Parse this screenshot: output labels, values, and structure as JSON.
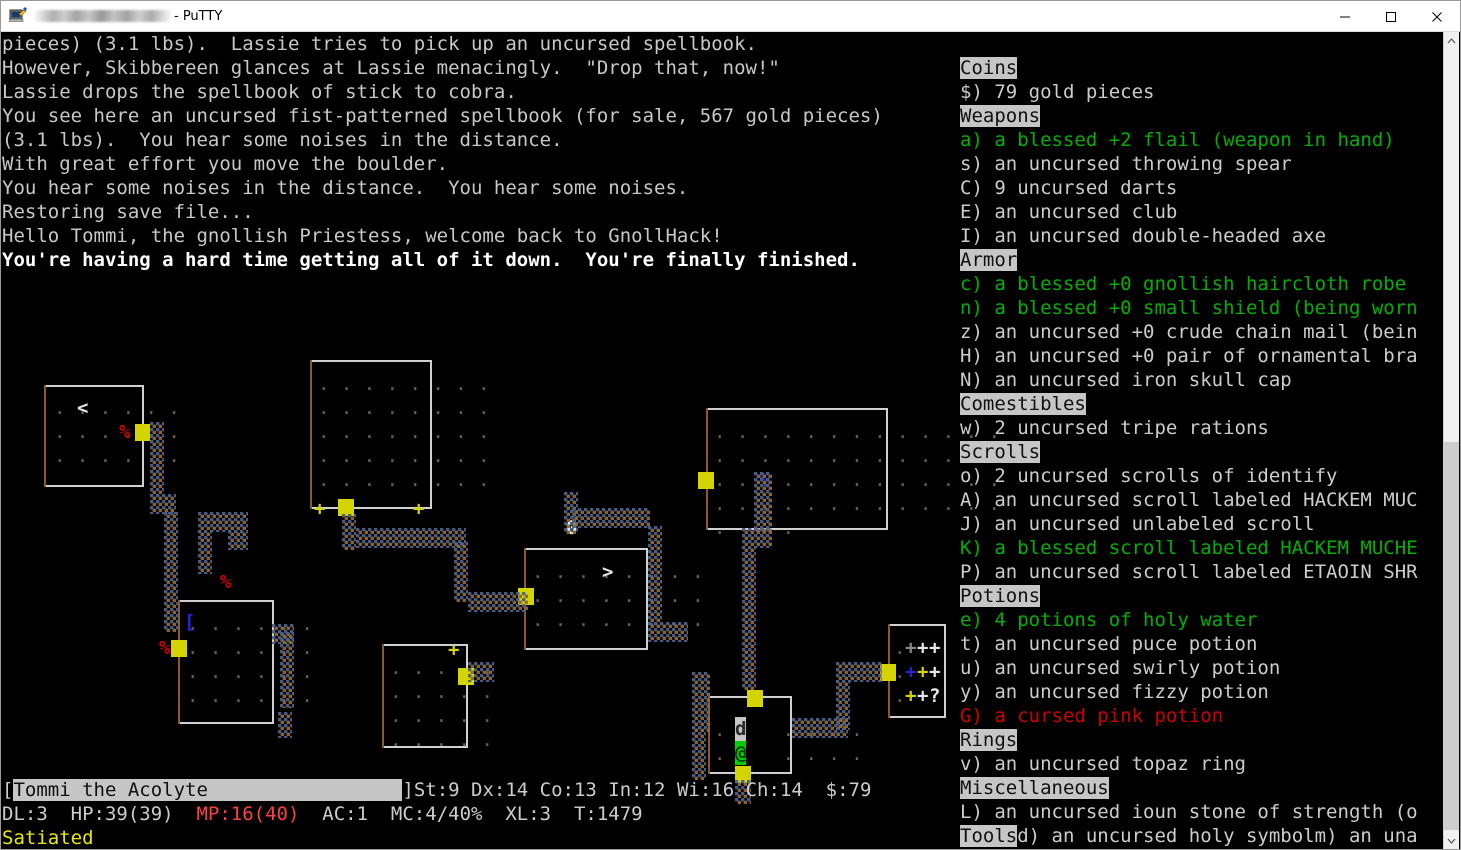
{
  "window": {
    "title_suffix": " - PuTTY",
    "title_redacted": true,
    "icon": "putty-icon",
    "controls": [
      {
        "name": "minimize-button",
        "label": "—"
      },
      {
        "name": "maximize-button",
        "label": "☐"
      },
      {
        "name": "close-button",
        "label": "✕"
      }
    ]
  },
  "messages": [
    {
      "text": "pieces) (3.1 lbs).  Lassie tries to pick up an uncursed spellbook.",
      "bold": false
    },
    {
      "text": "However, Skibbereen glances at Lassie menacingly.  \"Drop that, now!\"",
      "bold": false
    },
    {
      "text": "Lassie drops the spellbook of stick to cobra.",
      "bold": false
    },
    {
      "text": "You see here an uncursed fist-patterned spellbook (for sale, 567 gold pieces)",
      "bold": false
    },
    {
      "text": "(3.1 lbs).  You hear some noises in the distance.",
      "bold": false
    },
    {
      "text": "With great effort you move the boulder.",
      "bold": false
    },
    {
      "text": "You hear some noises in the distance.  You hear some noises.",
      "bold": false
    },
    {
      "text": "Restoring save file...",
      "bold": false
    },
    {
      "text": "Hello Tommi, the gnollish Priestess, welcome back to GnollHack!",
      "bold": false
    },
    {
      "text": "You're having a hard time getting all of it down.  You're finally finished.",
      "bold": true
    }
  ],
  "inventory": [
    {
      "kind": "category",
      "text": "Coins"
    },
    {
      "kind": "item",
      "letter": "$)",
      "text": " 79 gold pieces",
      "color": "white"
    },
    {
      "kind": "category",
      "text": "Weapons"
    },
    {
      "kind": "item",
      "letter": "a)",
      "text": " a blessed +2 flail (weapon in hand)",
      "color": "green"
    },
    {
      "kind": "item",
      "letter": "s)",
      "text": " an uncursed throwing spear",
      "color": "white"
    },
    {
      "kind": "item",
      "letter": "C)",
      "text": " 9 uncursed darts",
      "color": "white"
    },
    {
      "kind": "item",
      "letter": "E)",
      "text": " an uncursed club",
      "color": "white"
    },
    {
      "kind": "item",
      "letter": "I)",
      "text": " an uncursed double-headed axe",
      "color": "white"
    },
    {
      "kind": "category",
      "text": "Armor"
    },
    {
      "kind": "item",
      "letter": "c)",
      "text": " a blessed +0 gnollish haircloth robe",
      "color": "green"
    },
    {
      "kind": "item",
      "letter": "n)",
      "text": " a blessed +0 small shield (being worn",
      "color": "green"
    },
    {
      "kind": "item",
      "letter": "z)",
      "text": " an uncursed +0 crude chain mail (bein",
      "color": "white"
    },
    {
      "kind": "item",
      "letter": "H)",
      "text": " an uncursed +0 pair of ornamental bra",
      "color": "white"
    },
    {
      "kind": "item",
      "letter": "N)",
      "text": " an uncursed iron skull cap",
      "color": "white"
    },
    {
      "kind": "category",
      "text": "Comestibles"
    },
    {
      "kind": "item",
      "letter": "w)",
      "text": " 2 uncursed tripe rations",
      "color": "white"
    },
    {
      "kind": "category",
      "text": "Scrolls"
    },
    {
      "kind": "item",
      "letter": "o)",
      "text": " 2 uncursed scrolls of identify",
      "color": "white"
    },
    {
      "kind": "item",
      "letter": "A)",
      "text": " an uncursed scroll labeled HACKEM MUC",
      "color": "white"
    },
    {
      "kind": "item",
      "letter": "J)",
      "text": " an uncursed unlabeled scroll",
      "color": "white"
    },
    {
      "kind": "item",
      "letter": "K)",
      "text": " a blessed scroll labeled HACKEM MUCHE",
      "color": "green"
    },
    {
      "kind": "item",
      "letter": "P)",
      "text": " an uncursed scroll labeled ETAOIN SHR",
      "color": "white"
    },
    {
      "kind": "category",
      "text": "Potions"
    },
    {
      "kind": "item",
      "letter": "e)",
      "text": " 4 potions of holy water",
      "color": "green"
    },
    {
      "kind": "item",
      "letter": "t)",
      "text": " an uncursed puce potion",
      "color": "white"
    },
    {
      "kind": "item",
      "letter": "u)",
      "text": " an uncursed swirly potion",
      "color": "white"
    },
    {
      "kind": "item",
      "letter": "y)",
      "text": " an uncursed fizzy potion",
      "color": "white"
    },
    {
      "kind": "item",
      "letter": "G)",
      "text": " a cursed pink potion",
      "color": "red"
    },
    {
      "kind": "category",
      "text": "Rings"
    },
    {
      "kind": "item",
      "letter": "v)",
      "text": " an uncursed topaz ring",
      "color": "white"
    },
    {
      "kind": "category",
      "text": "Miscellaneous"
    },
    {
      "kind": "item",
      "letter": "L)",
      "text": " an uncursed ioun stone of strength (o",
      "color": "white"
    }
  ],
  "inventory_last_line": {
    "category": "Tools",
    "item_a": "d) an uncursed holy symbol",
    "item_b": "m) an una"
  },
  "status": {
    "name_bracket_open": "[",
    "name": "Tommi the Acolyte",
    "name_bracket_close": "]",
    "attributes": "St:9 Dx:14 Co:13 In:12 Wi:16 Ch:14  $:79",
    "line2_pre": "DL:3  HP:39(39)  ",
    "mp": "MP:16(40)",
    "line2_post": "  AC:1  MC:4/40%  XL:3  T:1479",
    "condition": "Satiated"
  },
  "map": {
    "legend": {
      "hero": "@",
      "pet": "d",
      "stairs_up": "<",
      "stairs_down": ">",
      "boulder": "0",
      "food_red": "%",
      "food_blue": "%",
      "armor_blue": "[",
      "door_yellow": "+",
      "scroll": "?",
      "spellbook": "+"
    },
    "shop_items": [
      [
        "+",
        "+",
        "+"
      ],
      [
        "+",
        "+",
        "+"
      ],
      [
        "+",
        "+",
        "?"
      ]
    ]
  },
  "scrollbar": {
    "up_arrow": "∧",
    "down_arrow": "∨"
  },
  "colors": {
    "green": "#00b000",
    "red": "#cc0000",
    "white": "#cccccc",
    "yellow": "#d4d400",
    "blue": "#2424e0",
    "category_bg": "#c6c6c6",
    "terminal_bg": "#000000"
  }
}
